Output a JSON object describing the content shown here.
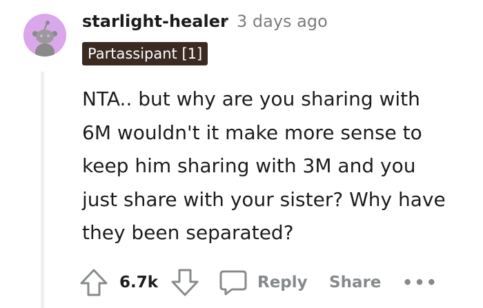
{
  "comment": {
    "username": "starlight-healer",
    "separator": "·",
    "timestamp": "3 days ago",
    "flair": "Partassipant [1]",
    "body": [
      "NTA.. but why are you sharing with",
      "6M wouldn't it make more sense to",
      "keep him sharing with 3M and you",
      "just share with your sister? Why have",
      "they been separated?"
    ],
    "score": "6.7k",
    "actions": {
      "reply_label": "Reply",
      "share_label": "Share",
      "more_label": "•••"
    }
  },
  "icons": {
    "avatar": "snoo-avatar-icon",
    "upvote": "upvote-arrow-icon",
    "downvote": "downvote-arrow-icon",
    "reply": "speech-bubble-icon"
  },
  "colors": {
    "avatar_bg": "#d9a7ea",
    "flair_bg": "#3b2a22",
    "muted": "#878a8c",
    "thread_line": "#edeff1"
  }
}
